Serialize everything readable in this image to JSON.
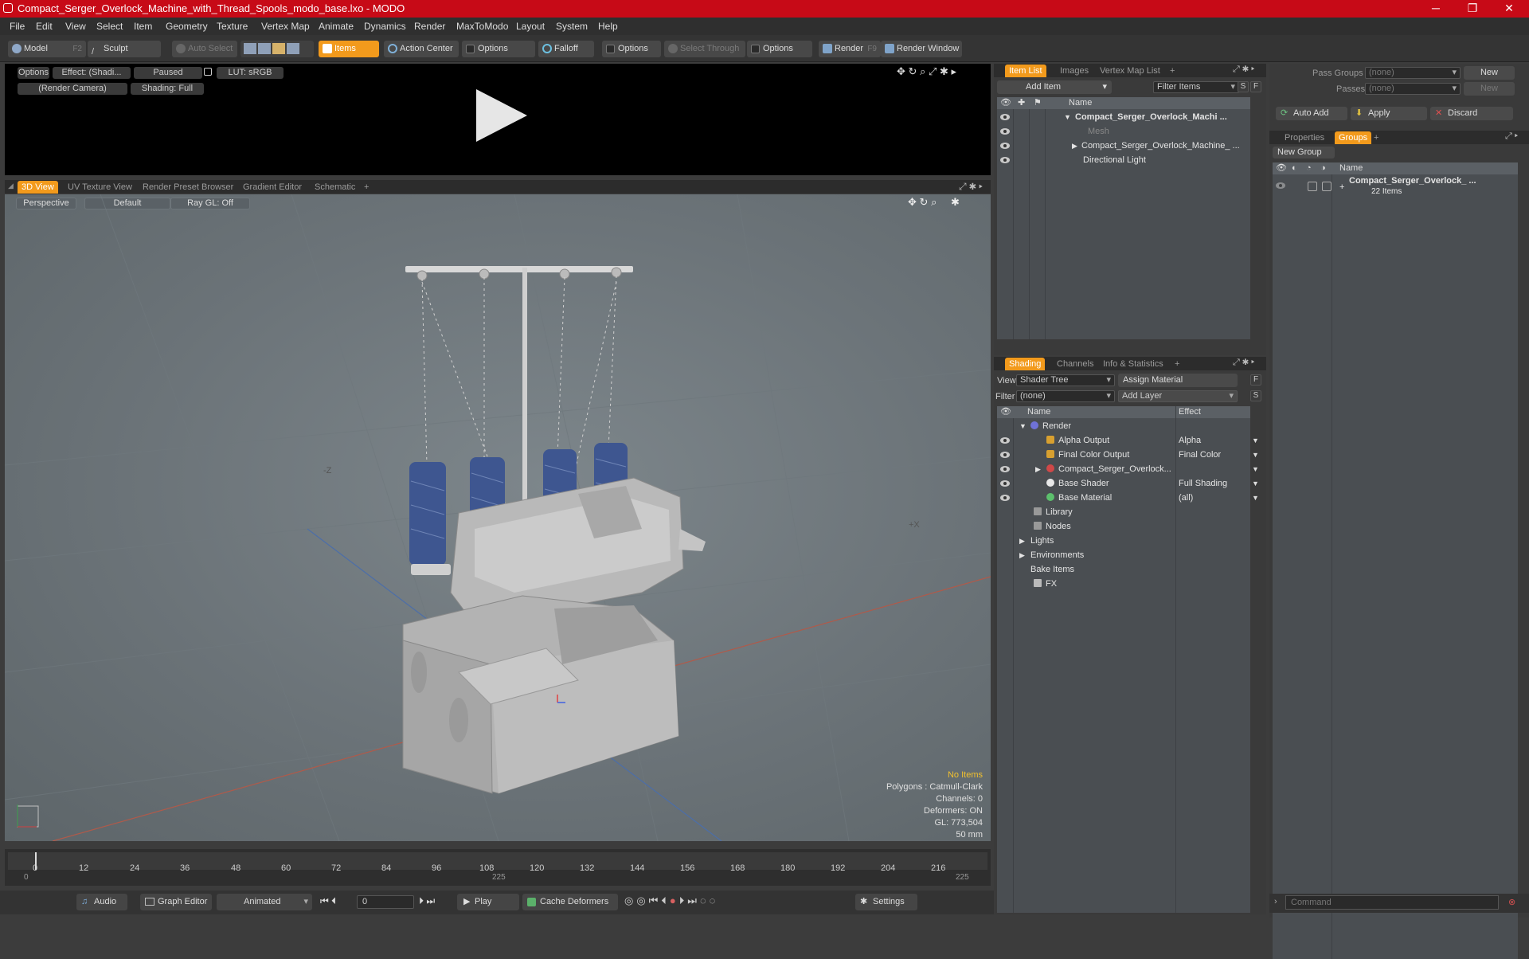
{
  "window": {
    "title": "Compact_Serger_Overlock_Machine_with_Thread_Spools_modo_base.lxo - MODO",
    "controls": [
      "─",
      "❐",
      "✕"
    ]
  },
  "menubar": [
    "File",
    "Edit",
    "View",
    "Select",
    "Item",
    "Geometry",
    "Texture",
    "Vertex Map",
    "Animate",
    "Dynamics",
    "Render",
    "MaxToModo",
    "Layout",
    "System",
    "Help"
  ],
  "toolbar": {
    "model": "Model",
    "model_key": "F2",
    "sculpt": "Sculpt",
    "auto_select": "Auto Select",
    "items": "Items",
    "action_center": "Action Center",
    "options1": "Options",
    "falloff": "Falloff",
    "options2": "Options",
    "select_through": "Select Through",
    "options3": "Options",
    "render": "Render",
    "render_key": "F9",
    "render_window": "Render Window"
  },
  "preview": {
    "options": "Options",
    "effect": "Effect: (Shadi...",
    "paused": "Paused",
    "lut": "LUT: sRGB",
    "camera": "(Render Camera)",
    "shading": "Shading: Full"
  },
  "view_tabs": [
    "3D View",
    "UV Texture View",
    "Render Preset Browser",
    "Gradient Editor",
    "Schematic",
    "+"
  ],
  "viewport": {
    "perspective": "Perspective",
    "default": "Default",
    "raygl": "Ray GL: Off",
    "axis_z": "-Z",
    "axis_x": "+X",
    "stats": {
      "no_items": "No Items",
      "polygons": "Polygons : Catmull-Clark",
      "channels": "Channels: 0",
      "deformers": "Deformers: ON",
      "gl": "GL: 773,504",
      "mm": "50 mm"
    }
  },
  "timeline": {
    "ticks": [
      "0",
      "12",
      "24",
      "36",
      "48",
      "60",
      "72",
      "84",
      "96",
      "108",
      "120",
      "132",
      "144",
      "156",
      "168",
      "180",
      "192",
      "204",
      "216"
    ],
    "start": "0",
    "mid": "225",
    "end": "225"
  },
  "bottombar": {
    "audio": "Audio",
    "graph_editor": "Graph Editor",
    "animated": "Animated",
    "frame": "0",
    "play": "Play",
    "cache_deformers": "Cache Deformers",
    "settings": "Settings"
  },
  "item_list": {
    "tabs": [
      "Item List",
      "Images",
      "Vertex Map List",
      "+"
    ],
    "add_item": "Add Item",
    "filter_items": "Filter Items",
    "col_name": "Name",
    "rows": [
      {
        "label": "Compact_Serger_Overlock_Machi ...",
        "bold": true
      },
      {
        "label": "Mesh",
        "dim": true
      },
      {
        "label": "Compact_Serger_Overlock_Machine_ ..."
      },
      {
        "label": "Directional Light"
      }
    ]
  },
  "shading": {
    "tabs": [
      "Shading",
      "Channels",
      "Info & Statistics",
      "+"
    ],
    "view_label": "View",
    "view_value": "Shader Tree",
    "assign_material": "Assign Material",
    "filter_label": "Filter",
    "filter_value": "(none)",
    "add_layer": "Add Layer",
    "col_name": "Name",
    "col_effect": "Effect",
    "rows": [
      {
        "label": "Render",
        "effect": ""
      },
      {
        "label": "Alpha Output",
        "effect": "Alpha"
      },
      {
        "label": "Final Color Output",
        "effect": "Final Color"
      },
      {
        "label": "Compact_Serger_Overlock...",
        "effect": ""
      },
      {
        "label": "Base Shader",
        "effect": "Full Shading"
      },
      {
        "label": "Base Material",
        "effect": "(all)"
      },
      {
        "label": "Library",
        "effect": ""
      },
      {
        "label": "Nodes",
        "effect": ""
      },
      {
        "label": "Lights",
        "effect": ""
      },
      {
        "label": "Environments",
        "effect": ""
      },
      {
        "label": "Bake Items",
        "effect": ""
      },
      {
        "label": "FX",
        "effect": ""
      }
    ]
  },
  "groups": {
    "pass_groups_label": "Pass Groups",
    "pass_groups_value": "(none)",
    "passes_label": "Passes",
    "passes_value": "(none)",
    "new1": "New",
    "new2": "New",
    "auto_add": "Auto Add",
    "apply": "Apply",
    "discard": "Discard",
    "tabs": [
      "Properties",
      "Groups",
      "+"
    ],
    "new_group": "New Group",
    "col_name": "Name",
    "group_name": "Compact_Serger_Overlock_ ...",
    "group_count": "22 Items"
  },
  "command": {
    "placeholder": "Command"
  }
}
